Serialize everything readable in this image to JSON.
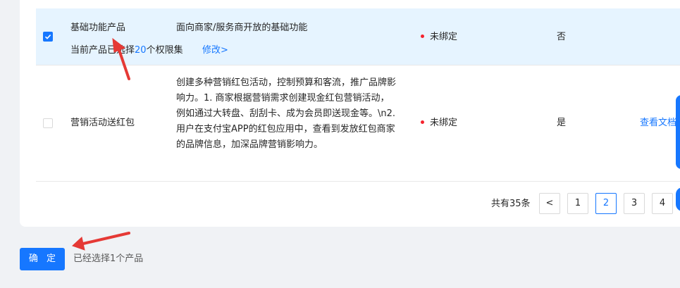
{
  "rows": [
    {
      "checked": true,
      "name": "基础功能产品",
      "description": "面向商家/服务商开放的基础功能",
      "sub_prefix": "当前产品已选择",
      "sub_count": "20",
      "sub_suffix": "个权限集",
      "modify_link": "修改>",
      "status": "未绑定",
      "flag": "否"
    },
    {
      "checked": false,
      "name": "营销活动送红包",
      "description": "创建多种营销红包活动，控制预算和客流，推广品牌影响力。1. 商家根据营销需求创建现金红包营销活动，例如通过大转盘、刮刮卡、成为会员即送现金等。\\n2. 用户在支付宝APP的红包应用中，查看到发放红包商家的品牌信息，加深品牌营销影响力。",
      "status": "未绑定",
      "flag": "是",
      "doc_link": "查看文档"
    }
  ],
  "pagination": {
    "total_label": "共有35条",
    "prev": "<",
    "pages": [
      "1",
      "2",
      "3",
      "4"
    ],
    "active_page": "2"
  },
  "footer": {
    "confirm_label": "确 定",
    "selected_text": "已经选择1个产品"
  },
  "colors": {
    "primary": "#1677ff",
    "selected_row_bg": "#e6f4ff",
    "status_dot": "#f5222d",
    "annotation_arrow": "#e53935"
  }
}
